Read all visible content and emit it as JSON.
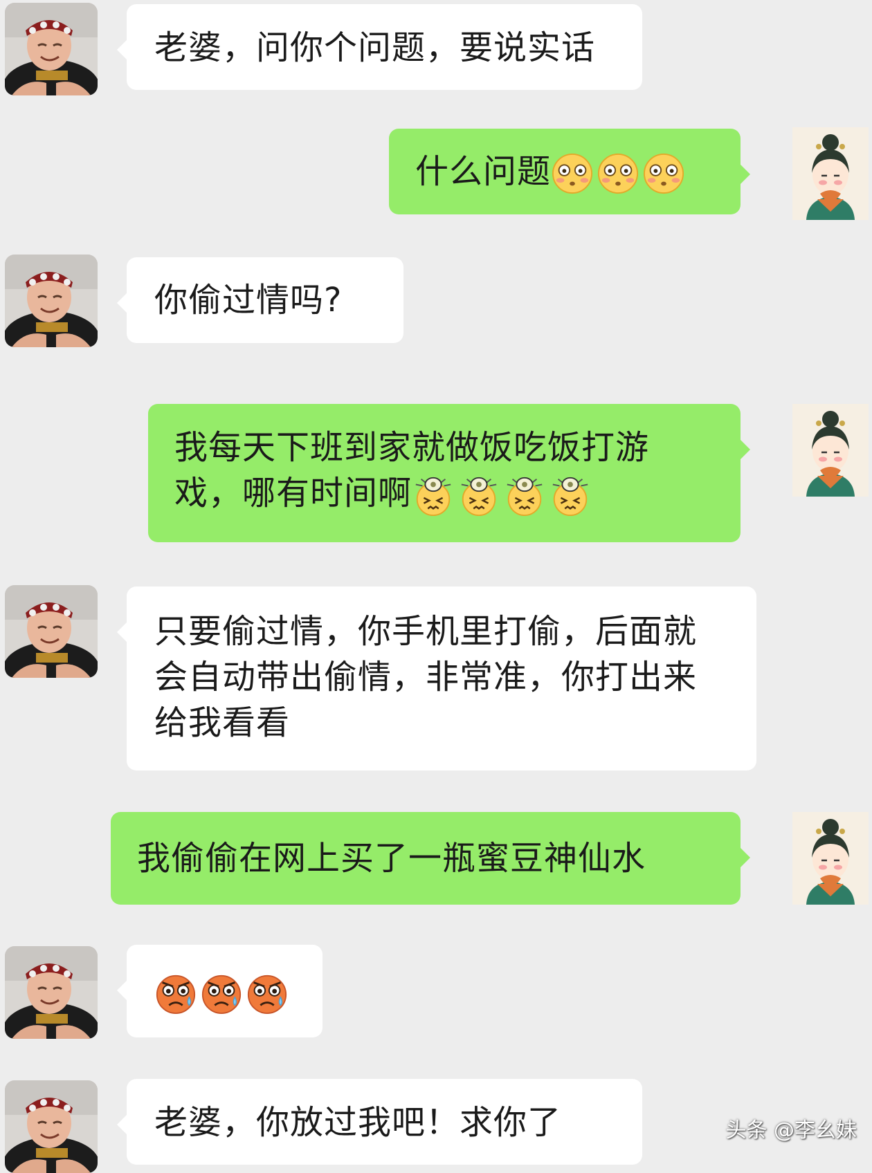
{
  "messages": [
    {
      "from": "husband",
      "text": "老婆，问你个问题，要说实话"
    },
    {
      "from": "wife",
      "text": "什么问题",
      "emoji": "flushed-face-emoji",
      "emoji_count": 3
    },
    {
      "from": "husband",
      "text": "你偷过情吗?"
    },
    {
      "from": "wife",
      "text": "我每天下班到家就做饭吃饭打游戏，哪有时间啊",
      "emoji": "confounded-face-emoji",
      "emoji_count": 4
    },
    {
      "from": "husband",
      "text": "只要偷过情，你手机里打偷，后面就会自动带出偷情，非常准，你打出来给我看看"
    },
    {
      "from": "wife",
      "text": "我偷偷在网上买了一瓶蜜豆神仙水"
    },
    {
      "from": "husband",
      "text": "",
      "emoji": "angry-sweat-face-emoji",
      "emoji_count": 3
    },
    {
      "from": "husband",
      "text": "老婆，你放过我吧！求你了"
    }
  ],
  "watermark": "头条 @李幺妹",
  "colors": {
    "background": "#ededed",
    "incoming_bubble": "#ffffff",
    "outgoing_bubble": "#95ec69"
  }
}
